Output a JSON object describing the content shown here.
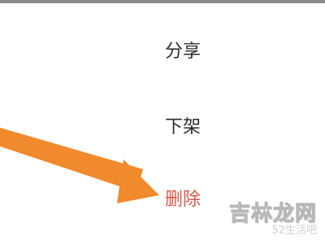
{
  "menu": {
    "items": [
      {
        "label": "分享"
      },
      {
        "label": "下架"
      },
      {
        "label": "删除"
      }
    ]
  },
  "colors": {
    "text": "#2b2b2b",
    "danger": "#d9574a",
    "arrow": "#f08a2c",
    "divider": "#8c8c8c"
  },
  "watermark": {
    "main": "吉林龙网",
    "sub": "52生活吧"
  }
}
